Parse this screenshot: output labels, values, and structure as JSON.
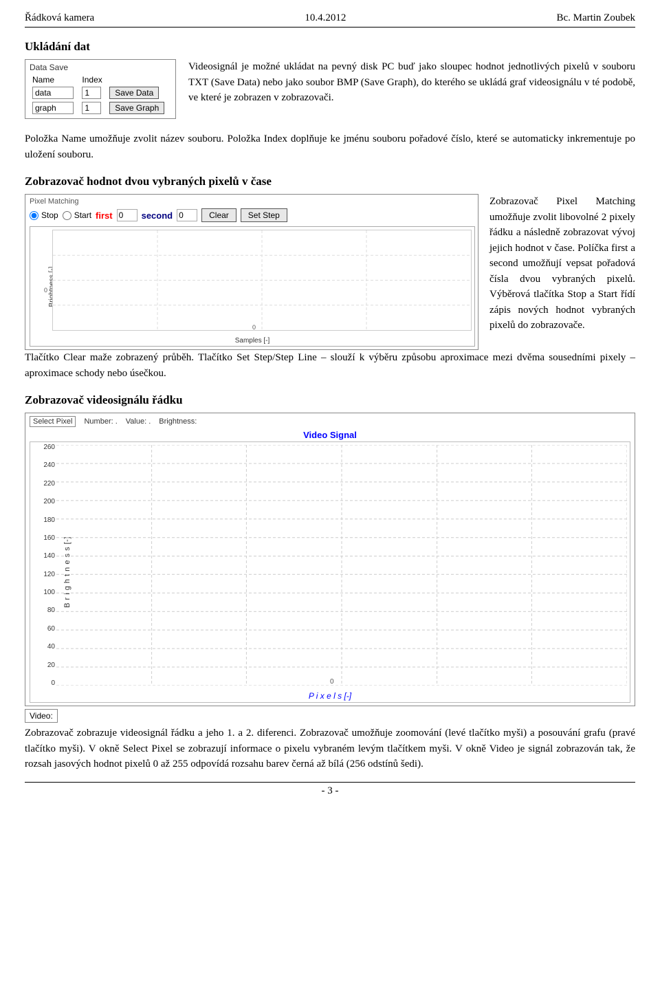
{
  "header": {
    "left": "Řádková kamera",
    "center": "10.4.2012",
    "right": "Bc. Martin Zoubek"
  },
  "section1": {
    "heading": "Ukládání dat",
    "box_title": "Data Save",
    "col_name": "Name",
    "col_index": "Index",
    "row1_name": "data",
    "row1_index": "1",
    "row1_btn": "Save Data",
    "row2_name": "graph",
    "row2_index": "1",
    "row2_btn": "Save Graph",
    "text": "Videosignál je možné ukládat na pevný disk PC buď jako sloupec hodnot jednotlivých pixelů v souboru TXT (Save Data) nebo jako soubor BMP (Save Graph), do kterého se ukládá graf videosignálu v té podobě, ve které je zobrazen v zobrazovači.",
    "bottom_text": "Položka Name umožňuje zvolit název souboru. Položka Index doplňuje ke jménu souboru pořadové číslo, které se automaticky inkrementuje po uložení souboru."
  },
  "section2": {
    "heading": "Zobrazovač hodnot dvou vybraných pixelů v čase",
    "box_title": "Pixel Matching",
    "radio_stop": "Stop",
    "radio_start": "Start",
    "label_first": "first",
    "input_first": "0",
    "label_second": "second",
    "input_second": "0",
    "btn_clear": "Clear",
    "btn_setstep": "Set Step",
    "chart_y_label": "Brightness [-]",
    "chart_y_zero": "0",
    "chart_x_label": "Samples [-]",
    "chart_x_zero": "0",
    "side_text": "Zobrazovač Pixel Matching umožňuje zvolit libovolné 2 pixely řádku a následně zobrazovat vývoj jejich hodnot v čase. Políčka first a second umožňují vepsat pořadová čísla dvou vybraných pixelů. Výběrová tlačítka Stop a Start řídí zápis nových hodnot vybraných pixelů do zobrazovače.",
    "bottom_text": "Tlačítko Clear maže zobrazený průběh. Tlačítko Set Step/Step Line – slouží k výběru způsobu aproximace mezi dvěma sousedními pixely – aproximace schody nebo úsečkou."
  },
  "section3": {
    "heading": "Zobrazovač videosignálu řádku",
    "box_title": "Select Pixel",
    "label_number": "Number: .",
    "label_value": "Value: .",
    "label_brightness": "Brightness:",
    "chart_title": "Video Signal",
    "chart_y_label": "B r i g h t n e s s [-]",
    "chart_x_label": "P i x e l s [-]",
    "chart_x_zero": "0",
    "y_ticks": [
      "260",
      "240",
      "220",
      "200",
      "180",
      "160",
      "140",
      "120",
      "100",
      "80",
      "60",
      "40",
      "20",
      "0"
    ],
    "video_label": "Video:",
    "bottom_text1": "Zobrazovač zobrazuje videosignál řádku a jeho 1. a 2. diferenci. Zobrazovač umožňuje zoomování (levé tlačítko myši) a posouvání grafu (pravé tlačítko myši). V okně Select Pixel se zobrazují informace o pixelu vybraném levým tlačítkem myši. V okně Video je signál zobrazován tak, že rozsah jasových hodnot pixelů 0 až 255 odpovídá rozsahu barev černá až bílá (256 odstínů šedi)."
  },
  "footer": {
    "page": "- 3 -"
  }
}
